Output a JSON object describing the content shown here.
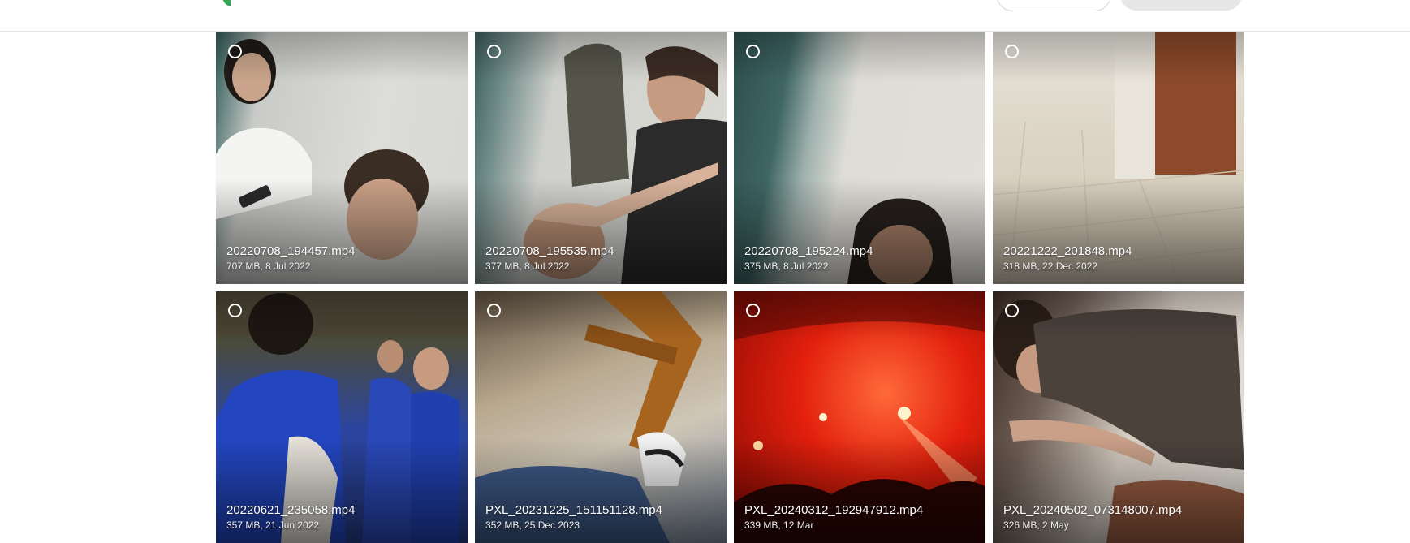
{
  "tiles": [
    {
      "name": "20220708_194457.mp4",
      "meta": "707 MB, 8 Jul 2022"
    },
    {
      "name": "20220708_195535.mp4",
      "meta": "377 MB, 8 Jul 2022"
    },
    {
      "name": "20220708_195224.mp4",
      "meta": "375 MB, 8 Jul 2022"
    },
    {
      "name": "20221222_201848.mp4",
      "meta": "318 MB, 22 Dec 2022"
    },
    {
      "name": "20220621_235058.mp4",
      "meta": "357 MB, 21 Jun 2022"
    },
    {
      "name": "PXL_20231225_151151128.mp4",
      "meta": "352 MB, 25 Dec 2023"
    },
    {
      "name": "PXL_20240312_192947912.mp4",
      "meta": "339 MB, 12 Mar"
    },
    {
      "name": "PXL_20240502_073148007.mp4",
      "meta": "326 MB, 2 May"
    }
  ]
}
